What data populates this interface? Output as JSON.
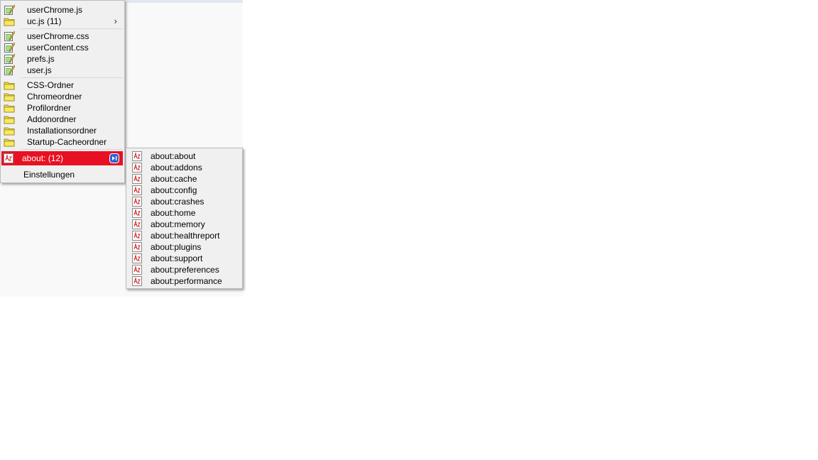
{
  "main_menu": {
    "items": [
      {
        "label": "userChrome.js",
        "icon": "edit-file-icon"
      },
      {
        "label": "uc.js (11)",
        "icon": "folder-icon",
        "has_submenu": true,
        "chevron": "›"
      },
      {
        "label": "userChrome.css",
        "icon": "edit-file-icon"
      },
      {
        "label": "userContent.css",
        "icon": "edit-file-icon"
      },
      {
        "label": "prefs.js",
        "icon": "edit-file-icon"
      },
      {
        "label": "user.js",
        "icon": "edit-file-icon"
      },
      {
        "label": "CSS-Ordner",
        "icon": "folder-icon"
      },
      {
        "label": "Chromeordner",
        "icon": "folder-icon"
      },
      {
        "label": "Profilordner",
        "icon": "folder-icon"
      },
      {
        "label": "Addonordner",
        "icon": "folder-icon"
      },
      {
        "label": "Installationsordner",
        "icon": "folder-icon"
      },
      {
        "label": "Startup-Cacheordner",
        "icon": "folder-icon"
      },
      {
        "label": "about: (12)",
        "icon": "about-page-icon",
        "selected": true,
        "has_submenu": true
      },
      {
        "label": "Einstellungen",
        "icon": ""
      }
    ]
  },
  "about_menu": {
    "items": [
      {
        "label": "about:about"
      },
      {
        "label": "about:addons"
      },
      {
        "label": "about:cache"
      },
      {
        "label": "about:config"
      },
      {
        "label": "about:crashes"
      },
      {
        "label": "about:home"
      },
      {
        "label": "about:memory"
      },
      {
        "label": "about:healthreport"
      },
      {
        "label": "about:plugins"
      },
      {
        "label": "about:support"
      },
      {
        "label": "about:preferences"
      },
      {
        "label": "about:performance"
      }
    ],
    "icon": "about-page-icon"
  },
  "colors": {
    "selected_bg": "#e81123",
    "menu_bg": "#f0f0f0",
    "folder_yellow": "#f5e54a",
    "submenu_arrow": "#2f5fd0"
  }
}
